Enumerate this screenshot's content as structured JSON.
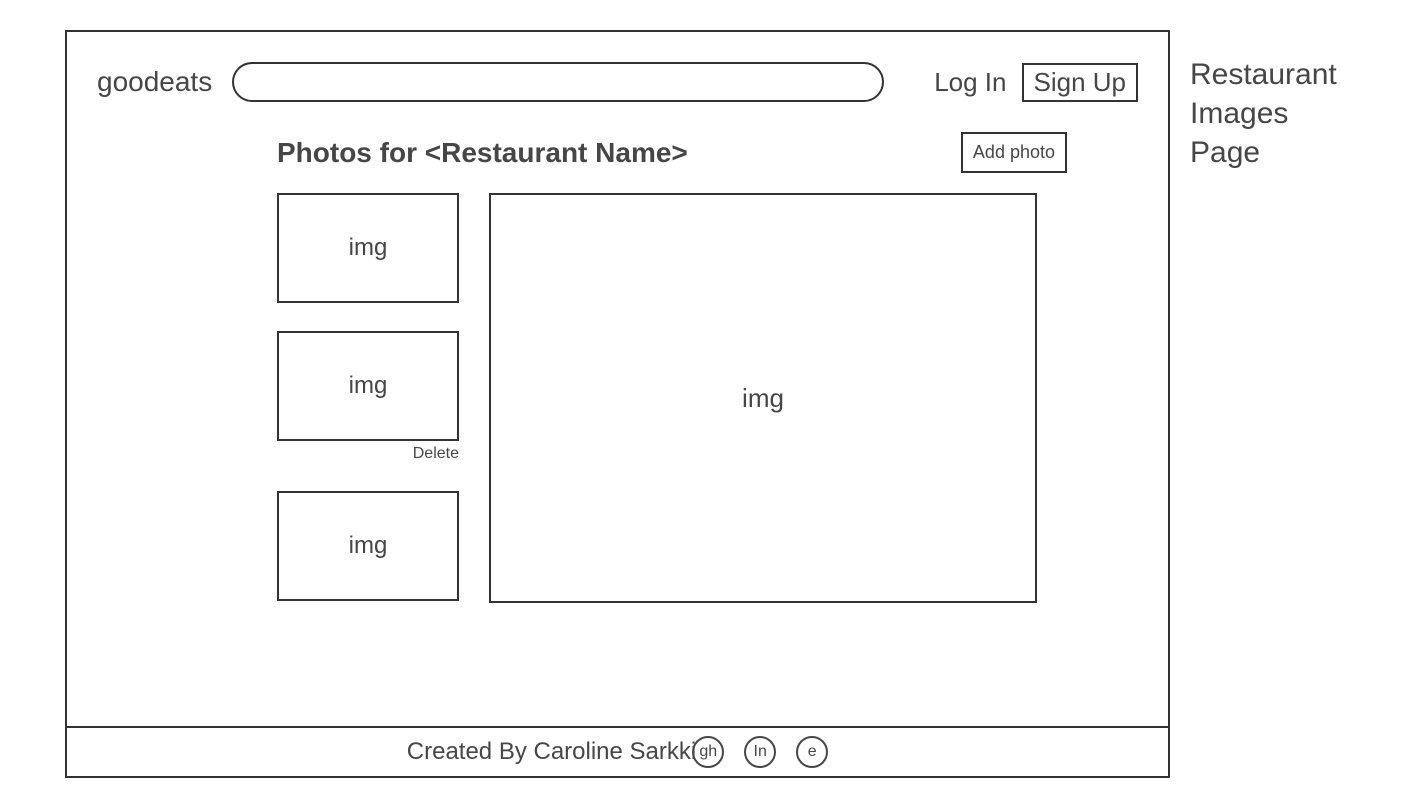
{
  "header": {
    "logo": "goodeats",
    "login_label": "Log In",
    "signup_label": "Sign Up"
  },
  "content": {
    "title": "Photos for <Restaurant Name>",
    "add_photo_label": "Add photo",
    "thumbs": [
      {
        "label": "img"
      },
      {
        "label": "img",
        "delete_label": "Delete"
      },
      {
        "label": "img"
      }
    ],
    "main_image_label": "img"
  },
  "footer": {
    "text_prefix": "Created By Caroline Sarkki",
    "icons": [
      {
        "label": "gh"
      },
      {
        "label": "In"
      },
      {
        "label": "e"
      }
    ]
  },
  "annotation": {
    "line1": "Restaurant",
    "line2": "Images",
    "line3": "Page"
  }
}
